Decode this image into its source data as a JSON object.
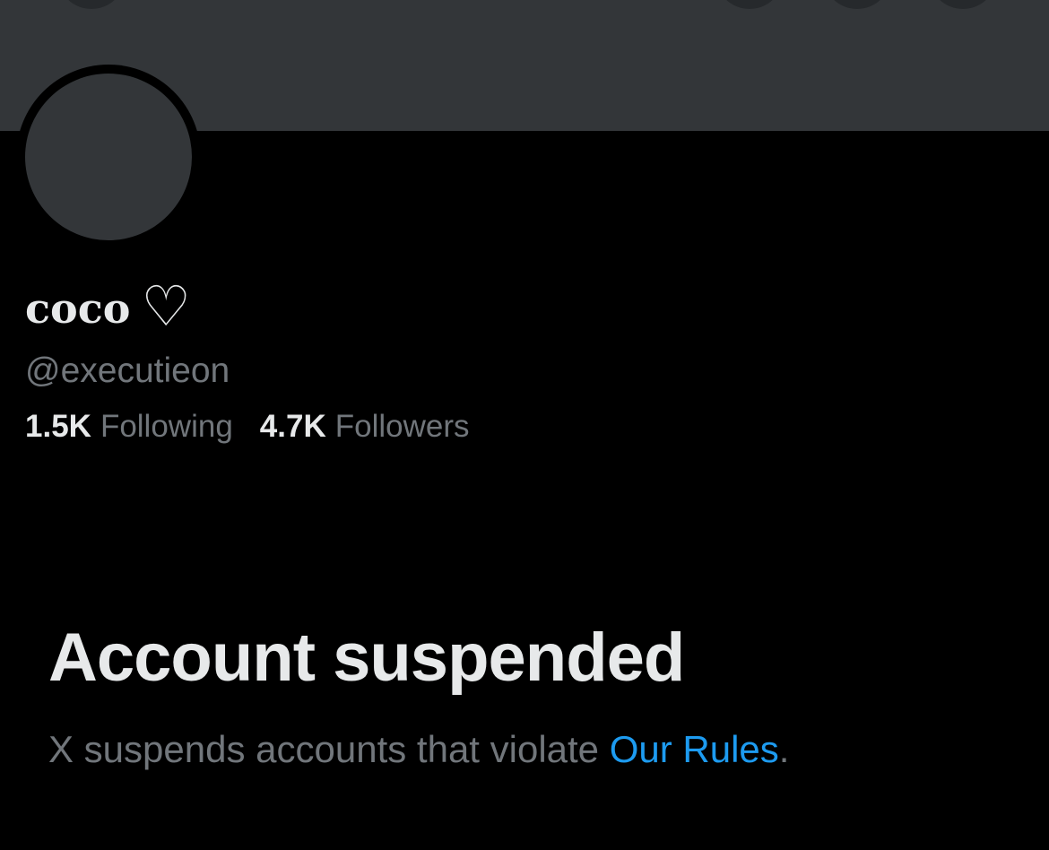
{
  "profile": {
    "display_name": "coco",
    "name_emoji": "♡",
    "handle": "@executieon",
    "following_count": "1.5K",
    "following_label": "Following",
    "followers_count": "4.7K",
    "followers_label": "Followers"
  },
  "suspension": {
    "title": "Account suspended",
    "message": "X suspends accounts that violate ",
    "link_text": "Our Rules",
    "message_end": "."
  },
  "colors": {
    "background": "#000000",
    "banner": "#333639",
    "primary_text": "#e7e9ea",
    "secondary_text": "#71767b",
    "link": "#1d9bf0"
  },
  "icons": {
    "back": "arrow-left-icon",
    "toolbar": [
      "search-icon",
      "share-icon",
      "more-icon"
    ]
  }
}
